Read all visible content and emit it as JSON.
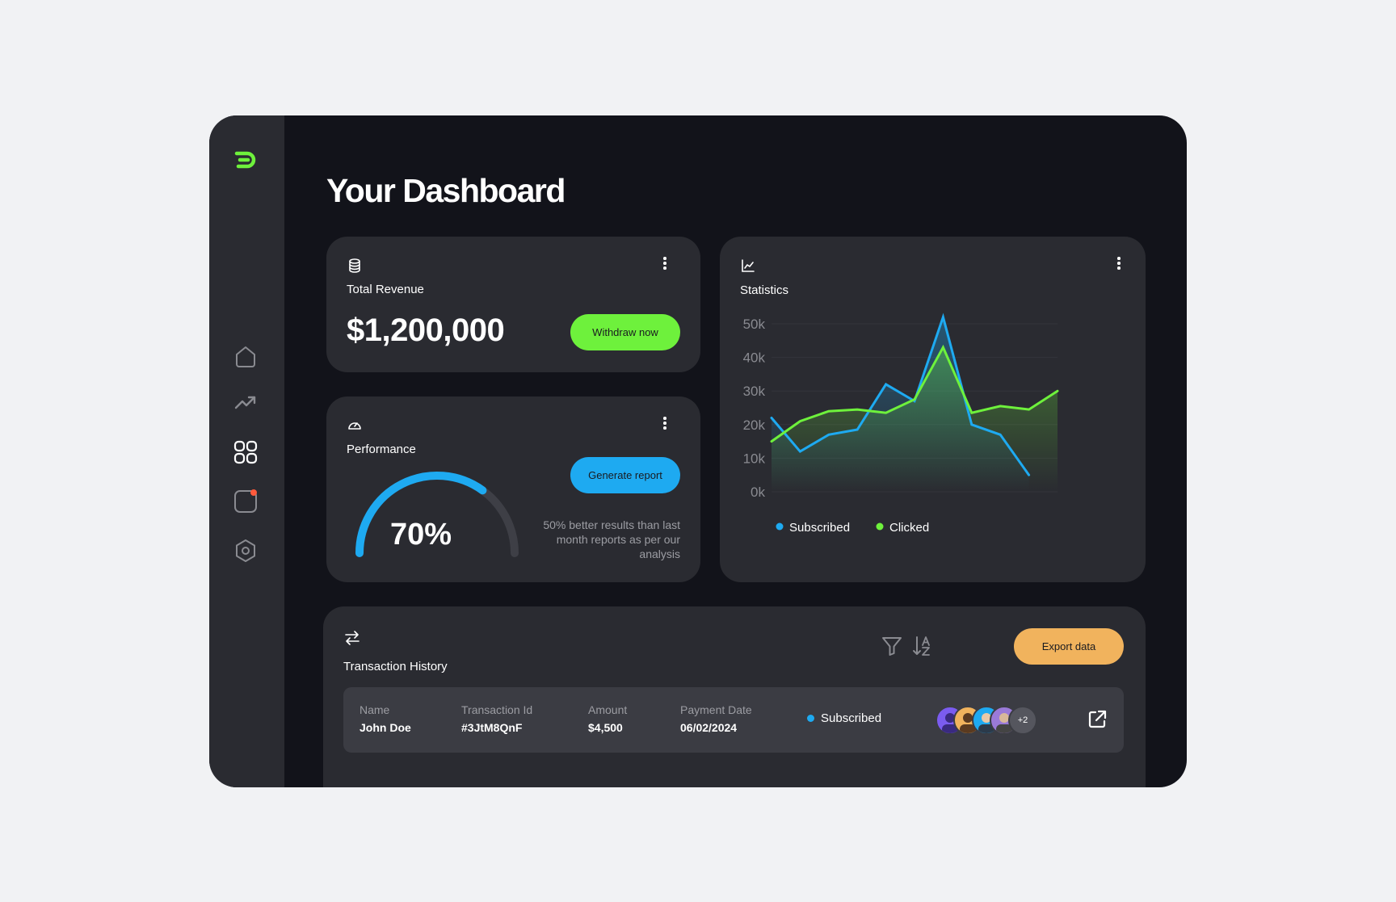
{
  "colors": {
    "accent_green": "#6ef13c",
    "accent_blue": "#1eaaf1",
    "accent_orange": "#f1b35d",
    "notification": "#ff5a3c",
    "card_bg": "#2a2b31",
    "app_bg": "#12131a"
  },
  "sidebar": {
    "logo": "brand-logo",
    "items": [
      {
        "name": "home",
        "icon": "home-icon"
      },
      {
        "name": "analytics",
        "icon": "trending-up-icon"
      },
      {
        "name": "apps",
        "icon": "grid-icon",
        "active": true
      },
      {
        "name": "notifications",
        "icon": "square-icon",
        "has_notification": true
      },
      {
        "name": "settings",
        "icon": "hexagon-settings-icon"
      }
    ]
  },
  "page": {
    "title": "Your Dashboard"
  },
  "revenue": {
    "icon": "database-icon",
    "title": "Total Revenue",
    "value": "$1,200,000",
    "button": "Withdraw now"
  },
  "performance": {
    "icon": "gauge-icon",
    "title": "Performance",
    "value": "70%",
    "progress": 0.7,
    "button": "Generate report",
    "note": "50% better results than last month reports as per our analysis"
  },
  "statistics": {
    "icon": "line-chart-icon",
    "title": "Statistics"
  },
  "chart_data": {
    "type": "area",
    "title": "Statistics",
    "y_ticks": [
      "50k",
      "40k",
      "30k",
      "20k",
      "10k",
      "0k"
    ],
    "ylim": [
      0,
      50000
    ],
    "grid": true,
    "legend_position": "bottom-left",
    "x": [
      0,
      1,
      2,
      3,
      4,
      5,
      6,
      7,
      8,
      9,
      10,
      11
    ],
    "series": [
      {
        "name": "Subscribed",
        "color": "#1eaaf1",
        "values": [
          22000,
          12000,
          17000,
          18500,
          32000,
          27000,
          52000,
          20000,
          17000,
          5000
        ]
      },
      {
        "name": "Clicked",
        "color": "#6ef13c",
        "values": [
          15000,
          21000,
          24000,
          24500,
          23500,
          27500,
          43000,
          23500,
          25500,
          24500,
          30000
        ]
      }
    ],
    "series_x": [
      [
        0,
        1,
        2,
        3,
        4,
        5,
        6,
        7,
        8,
        9
      ],
      [
        0,
        1,
        2,
        3,
        4,
        5,
        6,
        7,
        8,
        9,
        10
      ]
    ]
  },
  "transactions": {
    "icon": "swap-arrows-icon",
    "title": "Transaction History",
    "filter_icon": "filter-icon",
    "sort_icon": "sort-az-icon",
    "export_button": "Export data",
    "columns": [
      "Name",
      "Transaction Id",
      "Amount",
      "Payment Date"
    ],
    "rows": [
      {
        "name": "John Doe",
        "transaction_id": "#3JtM8QnF",
        "amount": "$4,500",
        "payment_date": "06/02/2024",
        "status": "Subscribed",
        "extra_members": "+2",
        "open_icon": "external-link-icon"
      }
    ]
  }
}
